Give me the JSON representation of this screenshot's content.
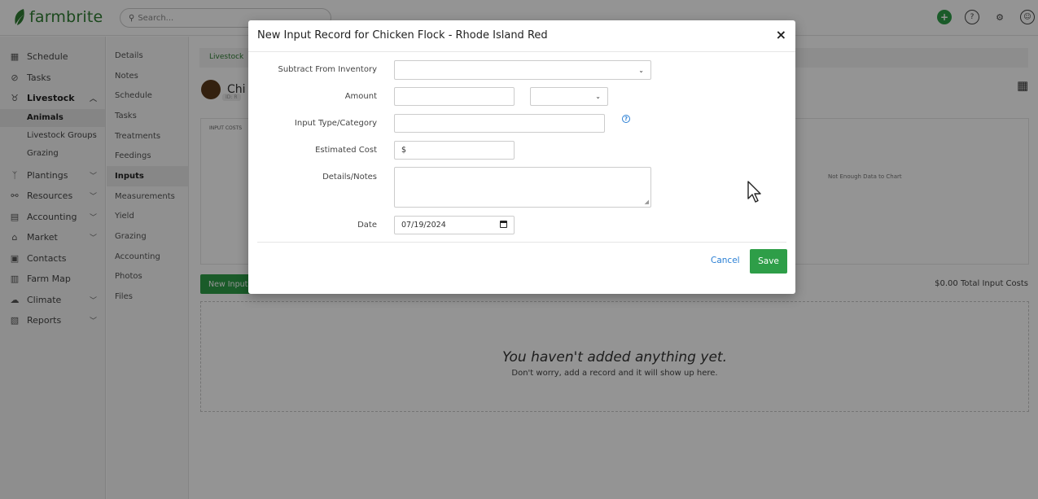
{
  "app": {
    "name": "farmbrite"
  },
  "search": {
    "placeholder": "Search..."
  },
  "top_icons": [
    "plus-circle-icon",
    "help-icon",
    "gear-icon",
    "account-icon"
  ],
  "sidebar": {
    "items": [
      {
        "label": "Schedule",
        "icon": "calendar-icon"
      },
      {
        "label": "Tasks",
        "icon": "check-circle-icon"
      },
      {
        "label": "Livestock",
        "icon": "cow-icon",
        "expanded": true,
        "children": [
          {
            "label": "Animals",
            "selected": true
          },
          {
            "label": "Livestock Groups"
          },
          {
            "label": "Grazing"
          }
        ]
      },
      {
        "label": "Plantings",
        "icon": "sprout-icon"
      },
      {
        "label": "Resources",
        "icon": "tools-icon"
      },
      {
        "label": "Accounting",
        "icon": "calculator-icon"
      },
      {
        "label": "Market",
        "icon": "store-icon"
      },
      {
        "label": "Contacts",
        "icon": "contact-icon"
      },
      {
        "label": "Farm Map",
        "icon": "map-icon"
      },
      {
        "label": "Climate",
        "icon": "cloud-icon"
      },
      {
        "label": "Reports",
        "icon": "report-icon"
      }
    ]
  },
  "subnav": {
    "items": [
      "Details",
      "Notes",
      "Schedule",
      "Tasks",
      "Treatments",
      "Feedings",
      "Inputs",
      "Measurements",
      "Yield",
      "Grazing",
      "Accounting",
      "Photos",
      "Files"
    ],
    "selected": "Inputs"
  },
  "main": {
    "breadcrumb": "Livestock",
    "animal_name": "Chi",
    "animal_id": "ID: R",
    "panel_label": "INPUT COSTS",
    "chart_empty": "Not Enough Data to Chart",
    "new_input_button": "New Input",
    "total_costs": "$0.00 Total Input Costs",
    "empty_title": "You haven't added anything yet.",
    "empty_subtitle": "Don't worry, add a record and it will show up here."
  },
  "modal": {
    "title": "New Input Record for Chicken Flock - Rhode Island Red",
    "close": "×",
    "fields": {
      "subtract_label": "Subtract From Inventory",
      "subtract_value": "",
      "amount_label": "Amount",
      "amount_value": "",
      "amount_unit": "",
      "type_label": "Input Type/Category",
      "type_value": "",
      "cost_label": "Estimated Cost",
      "cost_value": "$",
      "notes_label": "Details/Notes",
      "notes_value": "",
      "date_label": "Date",
      "date_value": "07/19/2024"
    },
    "cancel_label": "Cancel",
    "save_label": "Save"
  }
}
